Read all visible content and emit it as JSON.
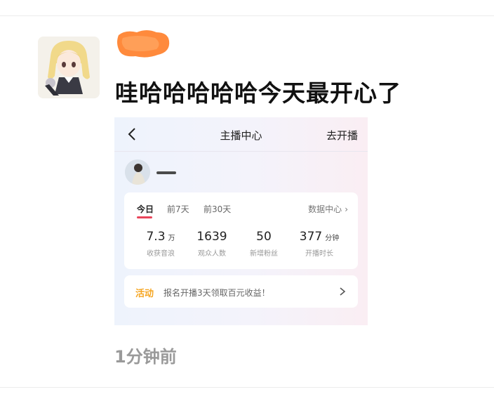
{
  "post": {
    "text": "哇哈哈哈哈哈今天最开心了",
    "time": "1分钟前"
  },
  "embedded": {
    "back_icon": "chevron-left-icon",
    "title": "主播中心",
    "go_live": "去开播",
    "tabs": [
      {
        "label": "今日",
        "active": true
      },
      {
        "label": "前7天",
        "active": false
      },
      {
        "label": "前30天",
        "active": false
      }
    ],
    "data_center": "数据中心",
    "stats": [
      {
        "value": "7.3",
        "unit": "万",
        "label": "收获音浪"
      },
      {
        "value": "1639",
        "unit": "",
        "label": "观众人数"
      },
      {
        "value": "50",
        "unit": "",
        "label": "新增粉丝"
      },
      {
        "value": "377",
        "unit": "分钟",
        "label": "开播时长"
      }
    ],
    "activity": {
      "tag": "活动",
      "text": "报名开播3天领取百元收益！"
    }
  },
  "colors": {
    "accent_red": "#e9445a",
    "activity_orange": "#f5a623",
    "censor_orange": "#ff8a3c"
  }
}
